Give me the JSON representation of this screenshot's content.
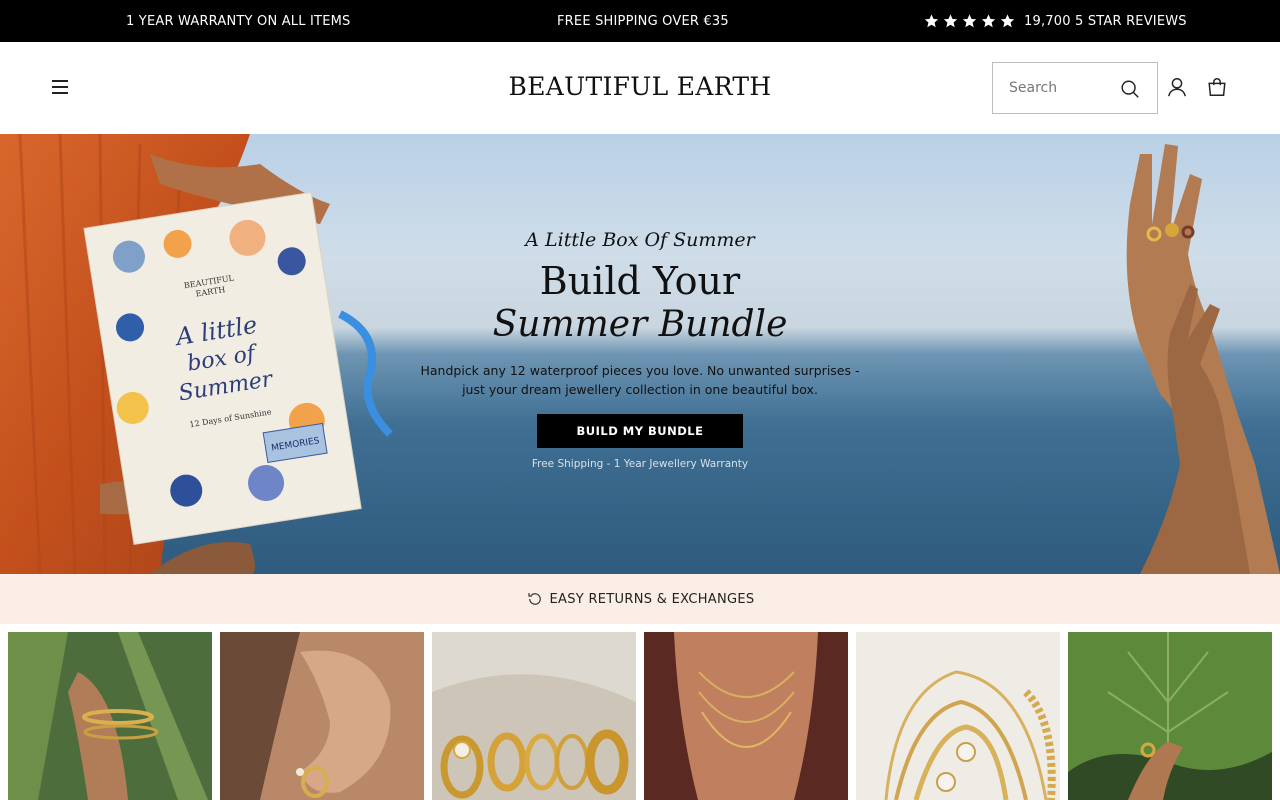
{
  "announcement": {
    "warranty": "1 YEAR WARRANTY ON ALL ITEMS",
    "shipping": "FREE SHIPPING OVER €35",
    "reviews": "19,700 5 STAR REVIEWS",
    "stars": 5
  },
  "header": {
    "logo": "BEAUTIFUL EARTH",
    "search_placeholder": "Search",
    "icons": [
      "menu-icon",
      "search-icon",
      "account-icon",
      "bag-icon"
    ]
  },
  "hero": {
    "eyebrow": "A Little Box Of Summer",
    "title_line1": "Build Your",
    "title_line2": "Summer Bundle",
    "subtitle_line1": "Handpick any 12 waterproof pieces you love. No unwanted surprises -",
    "subtitle_line2": "just your dream jewellery collection in one beautiful box.",
    "cta": "BUILD MY BUNDLE",
    "note": "Free Shipping - 1 Year Jewellery Warranty",
    "box_text": [
      "BEAUTIFUL EARTH",
      "A little box of Summer",
      "12 Days of Sunshine",
      "MEMORIES"
    ]
  },
  "returns_strip": {
    "label": "EASY RETURNS & EXCHANGES",
    "icon": "return-arrow-icon"
  },
  "category_tiles": [
    {
      "name": "bracelets-tile"
    },
    {
      "name": "earrings-tile"
    },
    {
      "name": "rings-tile"
    },
    {
      "name": "necklaces-tile"
    },
    {
      "name": "bracelet-stack-tile"
    },
    {
      "name": "rings-leaf-tile"
    }
  ],
  "colors": {
    "announcement_bg": "#000000",
    "returns_bg": "#fbeee6",
    "cta_bg": "#000000"
  }
}
